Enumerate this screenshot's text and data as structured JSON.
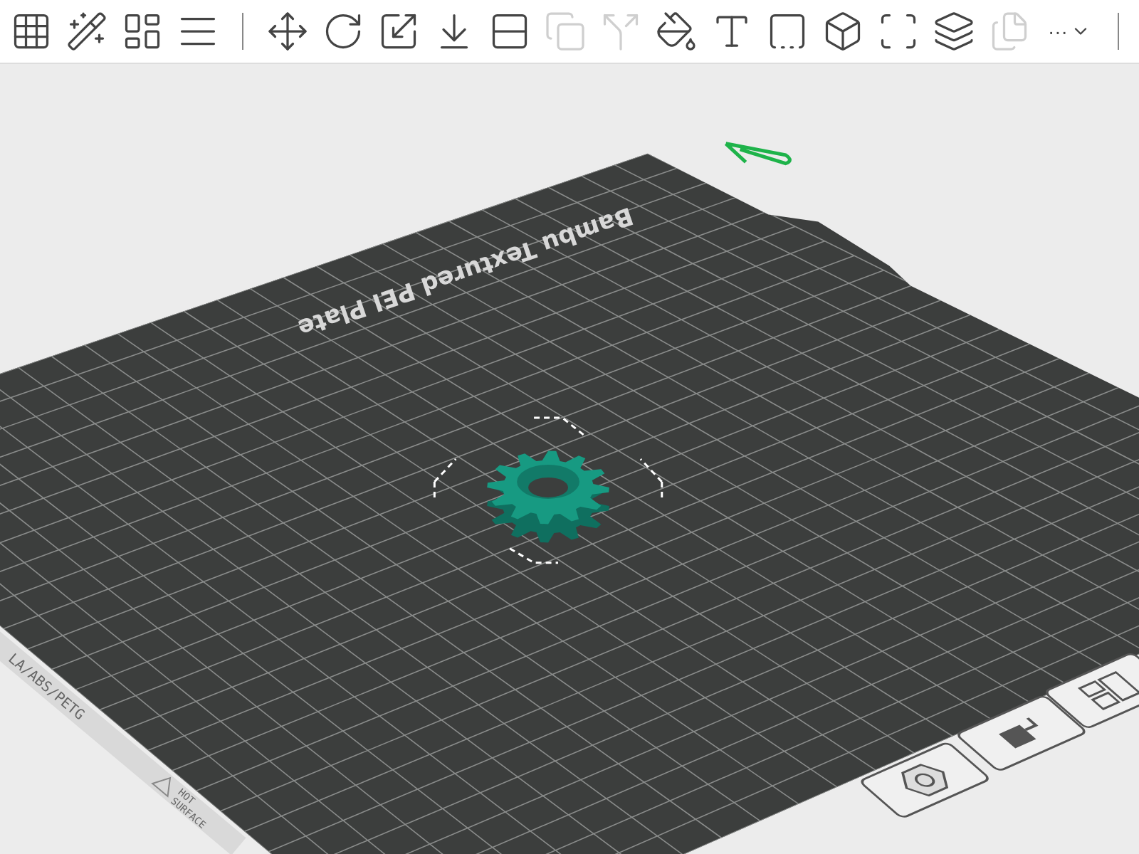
{
  "toolbar": {
    "tools": [
      {
        "disabled": false
      },
      {
        "disabled": false
      },
      {
        "disabled": false
      },
      {
        "disabled": false
      },
      {
        "disabled": false
      },
      {
        "disabled": false
      },
      {
        "disabled": false
      },
      {
        "disabled": false
      },
      {
        "disabled": false
      },
      {
        "disabled": true
      },
      {
        "disabled": true
      },
      {
        "disabled": false
      },
      {
        "disabled": false
      },
      {
        "disabled": false
      },
      {
        "disabled": false
      },
      {
        "disabled": false
      },
      {
        "disabled": false
      },
      {
        "disabled": true
      }
    ],
    "more_label": "···"
  },
  "plate": {
    "name": "Bambu Textured PEI Plate",
    "filament_label": "LA/ABS/PETG",
    "warning": [
      "HOT",
      "SURFACE"
    ]
  }
}
